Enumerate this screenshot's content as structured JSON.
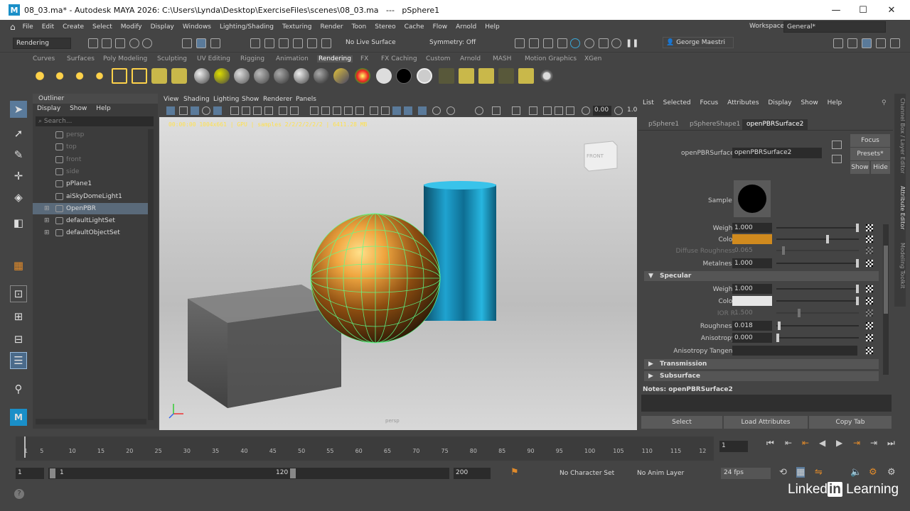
{
  "window": {
    "title": "08_03.ma* - Autodesk MAYA 2026: C:\\Users\\Lynda\\Desktop\\ExerciseFiles\\scenes\\08_03.ma   ---   pSphere1",
    "logo": "M"
  },
  "menus": [
    "File",
    "Edit",
    "Create",
    "Select",
    "Modify",
    "Display",
    "Windows",
    "Lighting/Shading",
    "Texturing",
    "Render",
    "Toon",
    "Stereo",
    "Cache",
    "Flow",
    "Arnold",
    "Help"
  ],
  "workspace": {
    "label": "Workspace:",
    "value": "General*"
  },
  "toolbar": {
    "mode": "Rendering",
    "live_surface": "No Live Surface",
    "symmetry": "Symmetry: Off",
    "user": "George Maestri"
  },
  "shelf_tabs": [
    "Curves",
    "Surfaces",
    "Poly Modeling",
    "Sculpting",
    "UV Editing",
    "Rigging",
    "Animation",
    "Rendering",
    "FX",
    "FX Caching",
    "Custom",
    "Arnold",
    "MASH",
    "Motion Graphics",
    "XGen"
  ],
  "shelf_active": "Rendering",
  "outliner": {
    "title": "Outliner",
    "menu": [
      "Display",
      "Show",
      "Help"
    ],
    "search": "Search...",
    "items": [
      {
        "label": "persp",
        "dim": true
      },
      {
        "label": "top",
        "dim": true
      },
      {
        "label": "front",
        "dim": true
      },
      {
        "label": "side",
        "dim": true
      },
      {
        "label": "pPlane1",
        "dim": false
      },
      {
        "label": "aiSkyDomeLight1",
        "dim": false
      },
      {
        "label": "OpenPBR",
        "dim": false,
        "selected": true
      },
      {
        "label": "defaultLightSet",
        "dim": false
      },
      {
        "label": "defaultObjectSet",
        "dim": false
      }
    ]
  },
  "viewport": {
    "menu": [
      "View",
      "Shading",
      "Lighting",
      "Show",
      "Renderer",
      "Panels"
    ],
    "exposure": "0.00",
    "gamma": "1.0",
    "hud": "00:00:00 1004x661 | GPU | samples 2/2/2/2/2/2 | 6411.28 MB",
    "cube_label": "FRONT",
    "cam_label": "persp"
  },
  "attr": {
    "menu": [
      "List",
      "Selected",
      "Focus",
      "Attributes",
      "Display",
      "Show",
      "Help"
    ],
    "tabs": [
      "pSphere1",
      "pSphereShape1",
      "openPBRSurface2"
    ],
    "node_label": "openPBRSurface:",
    "node_name": "openPBRSurface2",
    "focus": "Focus",
    "presets": "Presets*",
    "show": "Show",
    "hide": "Hide",
    "sample": "Sample",
    "weight_label": "Weight",
    "weight": "1.000",
    "color_label": "Color",
    "base_color": "#d08a1e",
    "diff_rough_label": "Diffuse Roughness",
    "diff_rough": "0.065",
    "metal_label": "Metalness",
    "metal": "1.000",
    "specular": "Specular",
    "spec_weight": "1.000",
    "spec_color": "#e6e6e6",
    "ior_label": "IOR R",
    "ior": "1.500",
    "rough_label": "Roughness",
    "rough": "0.018",
    "aniso_label": "Anisotropy",
    "aniso": "0.000",
    "aniso_tan": "Anisotropy Tangent",
    "transmission": "Transmission",
    "subsurface": "Subsurface",
    "notes": "Notes:  openPBRSurface2",
    "buttons": [
      "Select",
      "Load Attributes",
      "Copy Tab"
    ],
    "side_tabs": [
      "Channel Box / Layer Editor",
      "Attribute Editor",
      "Modeling Toolkit"
    ]
  },
  "timeline": {
    "ticks": [
      "1",
      "5",
      "10",
      "15",
      "20",
      "25",
      "30",
      "35",
      "40",
      "45",
      "50",
      "55",
      "60",
      "65",
      "70",
      "75",
      "80",
      "85",
      "90",
      "95",
      "100",
      "105",
      "110",
      "115",
      "12"
    ],
    "current": "1"
  },
  "range": {
    "start": "1",
    "inner_start": "1",
    "inner_end": "120",
    "end": "200",
    "char_set": "No Character Set",
    "anim_layer": "No Anim Layer",
    "fps": "24 fps"
  },
  "brand": {
    "a": "Linked",
    "b": "in",
    "c": " Learning"
  }
}
